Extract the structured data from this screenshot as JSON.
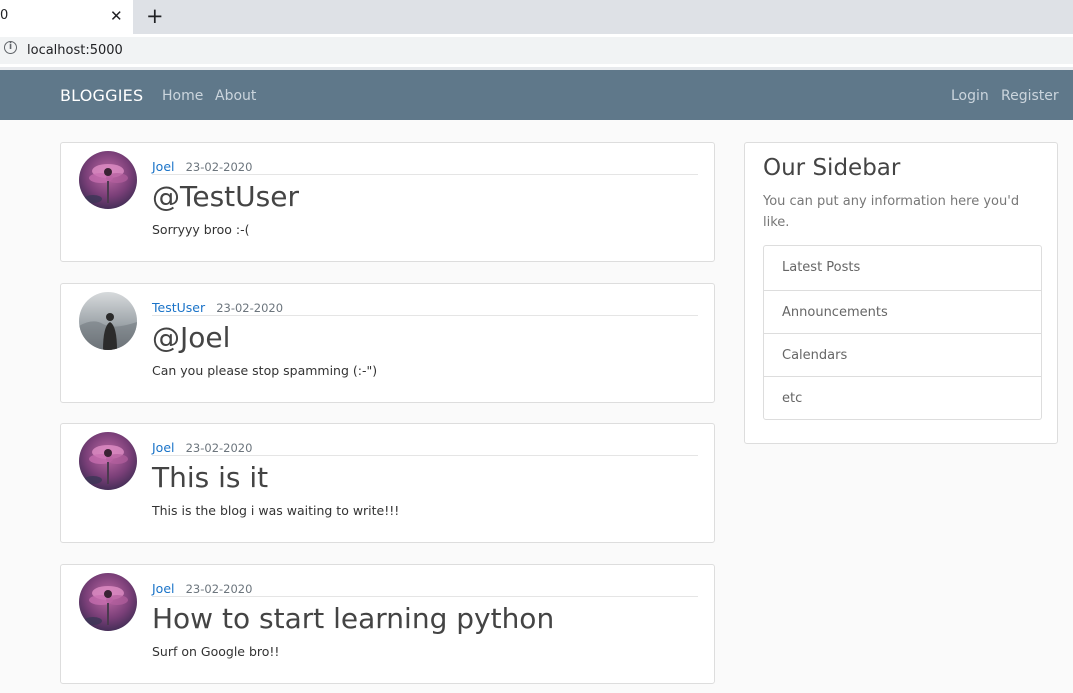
{
  "browser": {
    "tab_title": "0",
    "close_glyph": "✕",
    "new_tab_glyph": "+",
    "info_glyph": "i",
    "url": "localhost:5000"
  },
  "navbar": {
    "brand": "BLOGGIES",
    "links": [
      "Home",
      "About"
    ],
    "right_links": [
      "Login",
      "Register"
    ],
    "bg_color": "#5f788a"
  },
  "posts": [
    {
      "author": "Joel",
      "date": "23-02-2020",
      "title": "@TestUser",
      "body": "Sorryyy broo :-(",
      "avatar": "flower-avatar"
    },
    {
      "author": "TestUser",
      "date": "23-02-2020",
      "title": "@Joel",
      "body": "Can you please stop spamming (:-\")",
      "avatar": "person-avatar"
    },
    {
      "author": "Joel",
      "date": "23-02-2020",
      "title": "This is it",
      "body": "This is the blog i was waiting to write!!!",
      "avatar": "flower-avatar"
    },
    {
      "author": "Joel",
      "date": "23-02-2020",
      "title": "How to start learning python",
      "body": "Surf on Google bro!!",
      "avatar": "flower-avatar"
    }
  ],
  "sidebar": {
    "title": "Our Sidebar",
    "description": "You can put any information here you'd like.",
    "items": [
      "Latest Posts",
      "Announcements",
      "Calendars",
      "etc"
    ]
  },
  "colors": {
    "author_link": "#1a73c8",
    "page_bg": "#fafafa"
  }
}
